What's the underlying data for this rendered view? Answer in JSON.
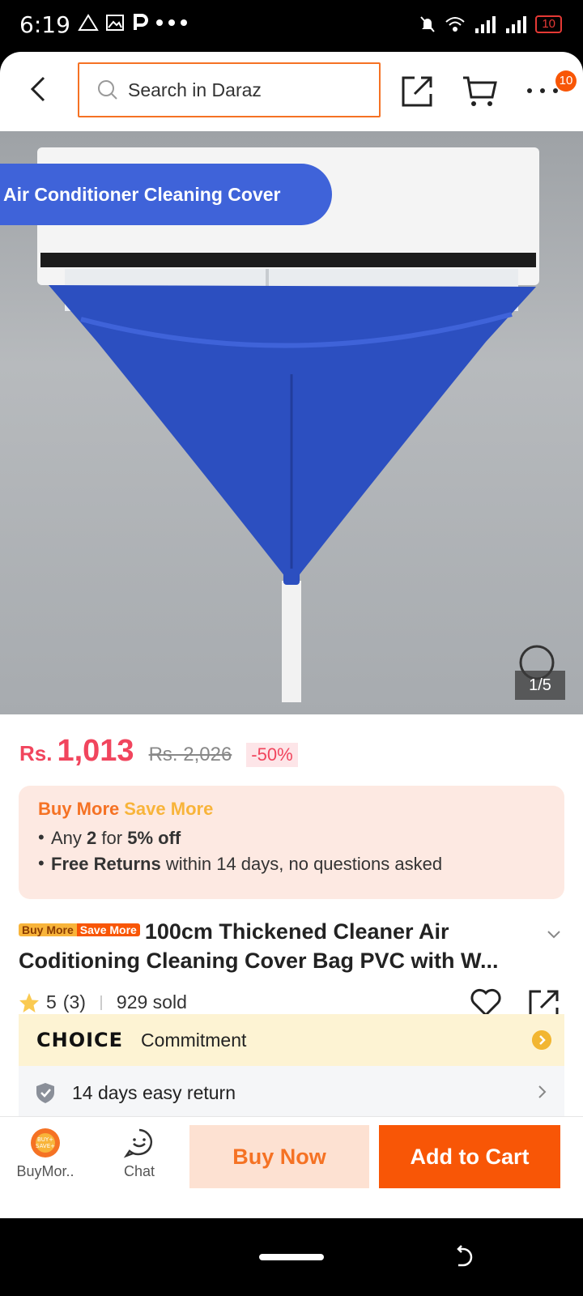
{
  "status_bar": {
    "time": "6:19",
    "battery": "10"
  },
  "header": {
    "search_placeholder": "Search in Daraz",
    "menu_badge": "10",
    "icons": [
      "back-arrow-icon",
      "search-icon",
      "share-icon",
      "cart-icon",
      "more-dots-icon"
    ]
  },
  "gallery": {
    "banner_text": "Air Conditioner Cleaning Cover",
    "counter": "1/5"
  },
  "price": {
    "currency": "Rs.",
    "current": "1,013",
    "original": "Rs. 2,026",
    "discount": "-50%"
  },
  "promo": {
    "title_a": "Buy More",
    "title_b": "Save More",
    "line1_prefix": "Any",
    "line1_qty": "2",
    "line1_mid": "for",
    "line1_off": "5% off",
    "line2_bold": "Free Returns",
    "line2_rest": "within 14 days, no questions asked"
  },
  "product": {
    "tag_a": "Buy More",
    "tag_b": "Save More",
    "title": "100cm Thickened Cleaner Air Coditioning Cleaning Cover Bag PVC with W...",
    "rating": "5",
    "reviews": "(3)",
    "sold": "929 sold"
  },
  "choice": {
    "logo": "CHOICE",
    "text": "Commitment"
  },
  "returns": {
    "text": "14 days easy return"
  },
  "bottom_bar": {
    "buymore_label": "BuyMor..",
    "chat_label": "Chat",
    "buy_now": "Buy Now",
    "add_to_cart": "Add to Cart"
  },
  "colors": {
    "accent": "#f85606",
    "price": "#f1455d",
    "banner": "#3f63d9"
  }
}
